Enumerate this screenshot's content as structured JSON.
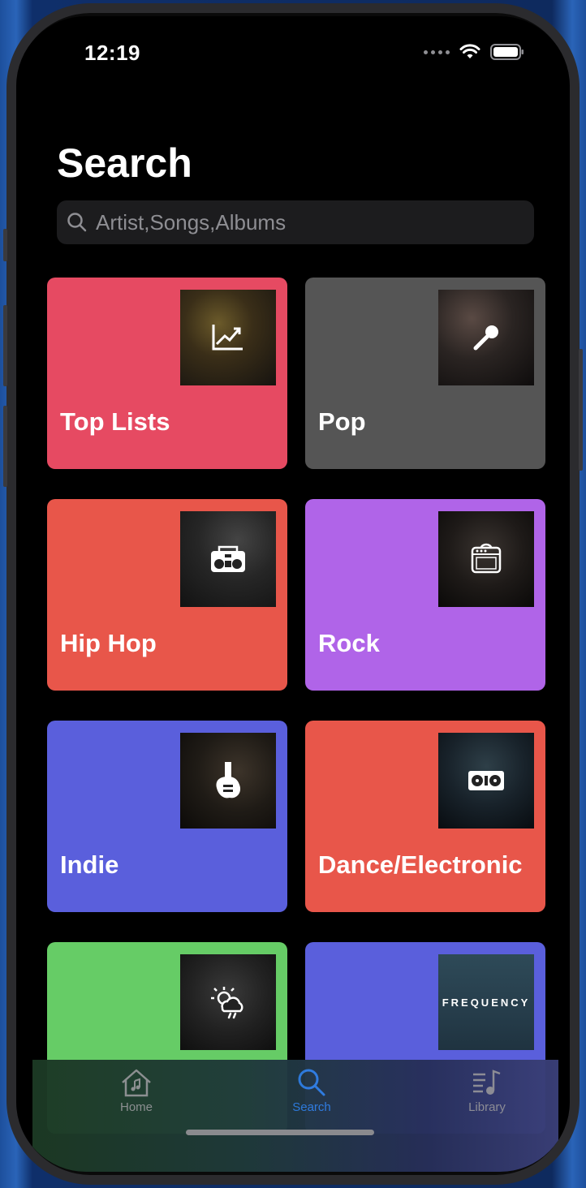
{
  "status_bar": {
    "time": "12:19"
  },
  "header": {
    "title": "Search"
  },
  "search": {
    "placeholder": "Artist,Songs,Albums"
  },
  "categories": [
    {
      "label": "Top Lists",
      "color": "#e64a62",
      "icon": "chart-trend-icon"
    },
    {
      "label": "Pop",
      "color": "#555555",
      "icon": "microphone-icon"
    },
    {
      "label": "Hip Hop",
      "color": "#e8564a",
      "icon": "boombox-icon"
    },
    {
      "label": "Rock",
      "color": "#b064e8",
      "icon": "amplifier-icon"
    },
    {
      "label": "Indie",
      "color": "#5a5fdc",
      "icon": "electric-guitar-icon"
    },
    {
      "label": "Dance/Electronic",
      "color": "#e8564a",
      "icon": "turntable-icon"
    },
    {
      "label": "",
      "color": "#66cc66",
      "icon": "weather-icon"
    },
    {
      "label": "",
      "color": "#5a5fdc",
      "icon": "frequency-logo",
      "art_text": "FREQUENCY"
    }
  ],
  "tabbar": {
    "items": [
      {
        "label": "Home",
        "icon": "home-icon",
        "active": false
      },
      {
        "label": "Search",
        "icon": "search-icon",
        "active": true
      },
      {
        "label": "Library",
        "icon": "library-icon",
        "active": false
      }
    ],
    "active_color": "#2f7de1",
    "inactive_color": "#8e8e93"
  }
}
